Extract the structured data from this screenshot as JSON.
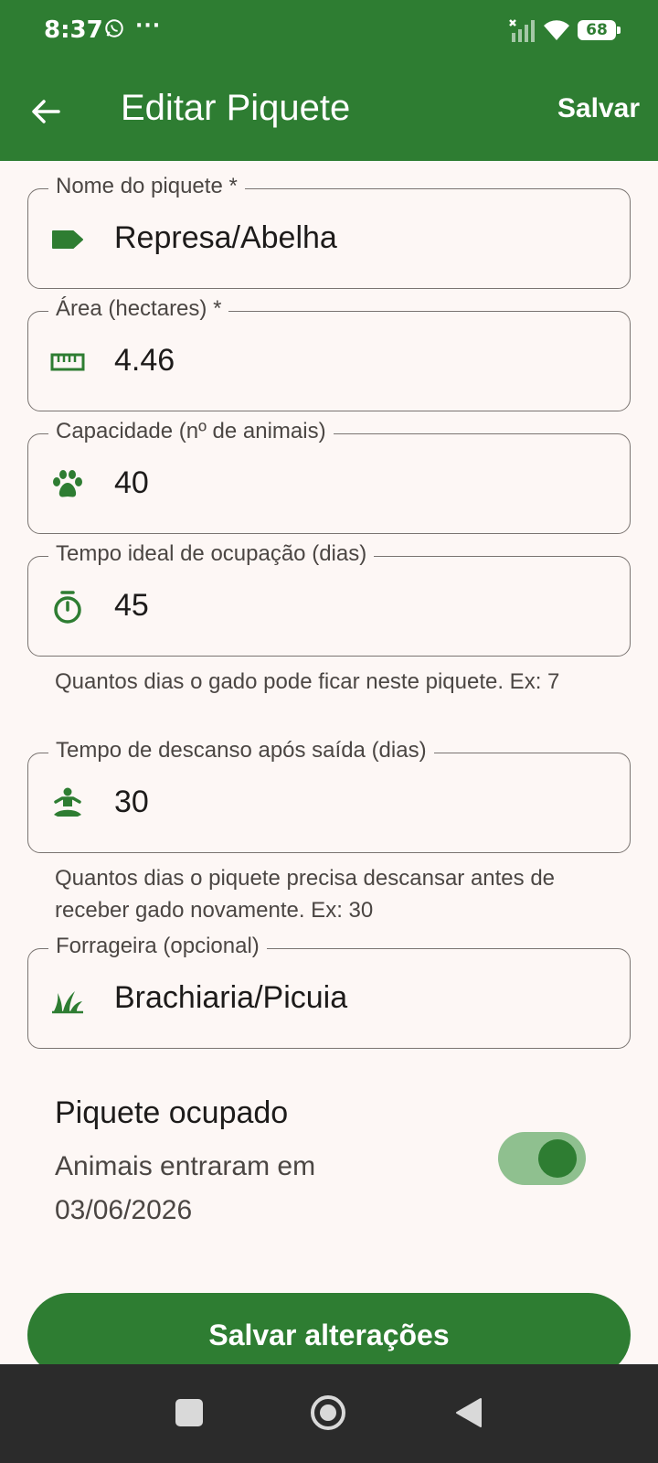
{
  "status_bar": {
    "time": "8:37",
    "more": "···",
    "battery": "68"
  },
  "app_bar": {
    "title": "Editar Piquete",
    "save_label": "Salvar"
  },
  "fields": [
    {
      "label": "Nome do piquete *",
      "value": "Represa/Abelha",
      "icon": "label-icon"
    },
    {
      "label": "Área (hectares) *",
      "value": "4.46",
      "icon": "ruler-icon"
    },
    {
      "label": "Capacidade (nº de animais)",
      "value": "40",
      "icon": "paw-icon"
    },
    {
      "label": "Tempo ideal de ocupação (dias)",
      "value": "45",
      "icon": "timer-icon",
      "helper": "Quantos dias o gado pode ficar neste piquete. Ex: 7"
    },
    {
      "label": "Tempo de descanso após saída (dias)",
      "value": "30",
      "icon": "meditation-icon",
      "helper": "Quantos dias o piquete precisa descansar antes de receber gado novamente. Ex: 30"
    },
    {
      "label": "Forrageira (opcional)",
      "value": "Brachiaria/Picuia",
      "icon": "grass-icon"
    }
  ],
  "occupied": {
    "title": "Piquete ocupado",
    "subtitle": "Animais entraram em 03/06/2026",
    "enabled": true
  },
  "save_button": {
    "label": "Salvar alterações"
  },
  "colors": {
    "primary": "#2e7d32",
    "background": "#fdf7f5",
    "toggle_track": "#8fc08f"
  }
}
